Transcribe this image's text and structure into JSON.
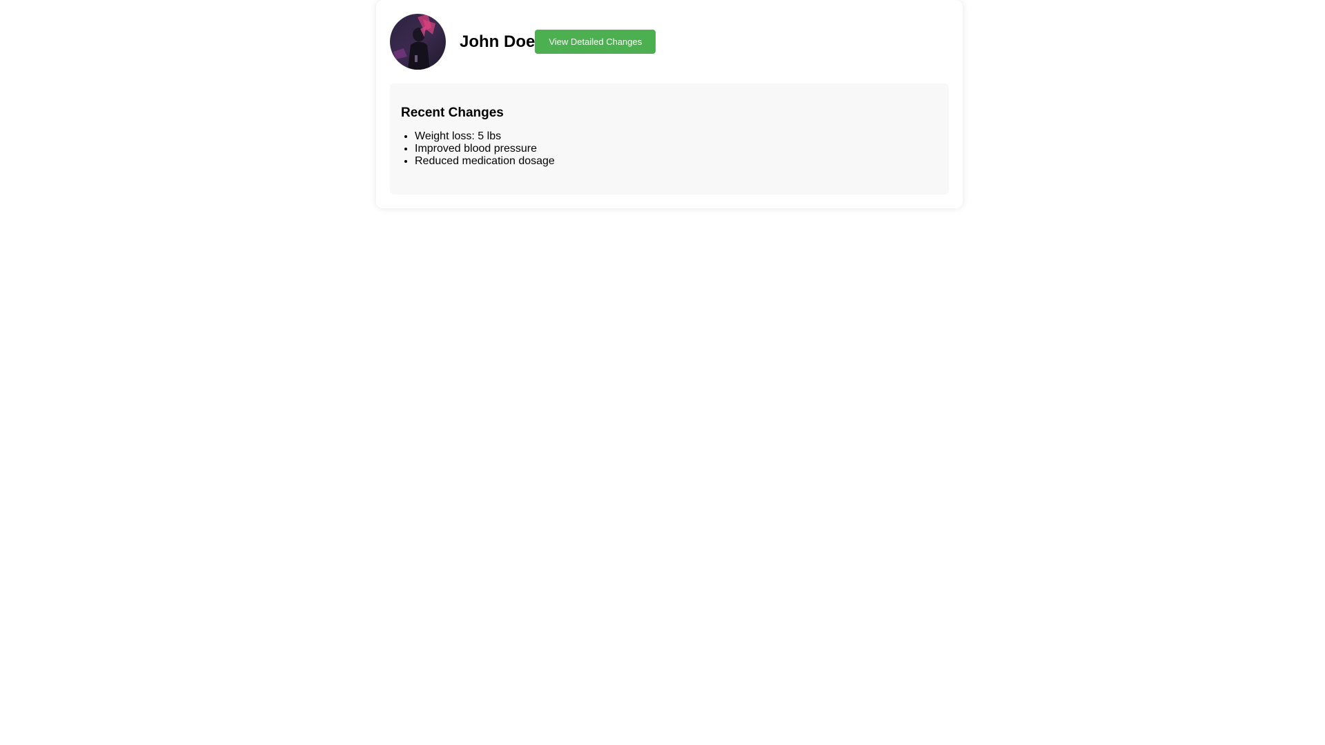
{
  "profile": {
    "name": "John Doe",
    "avatar_icon": "user-photo-avatar"
  },
  "actions": {
    "view_changes_label": "View Detailed Changes",
    "accent_color": "#4caf50"
  },
  "recent_changes": {
    "title": "Recent Changes",
    "items": [
      "Weight loss: 5 lbs",
      "Improved blood pressure",
      "Reduced medication dosage"
    ]
  }
}
